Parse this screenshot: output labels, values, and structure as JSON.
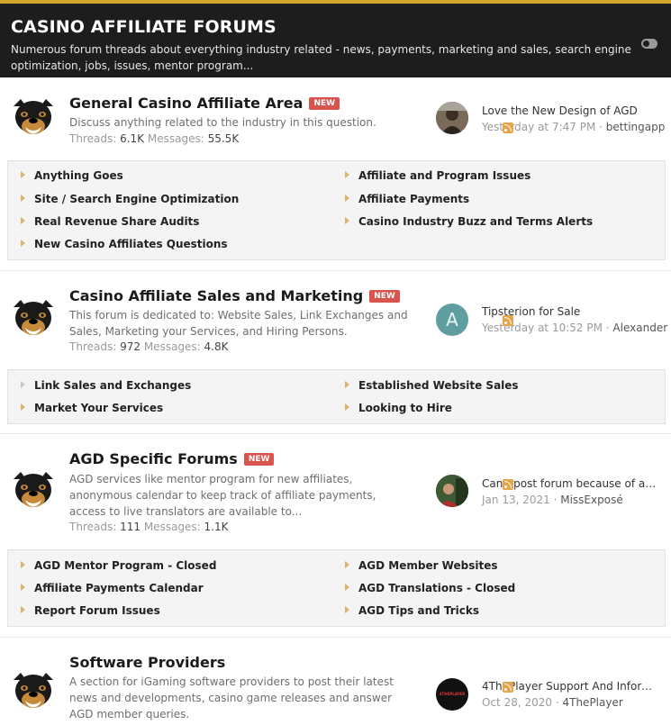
{
  "header": {
    "title": "CASINO AFFILIATE FORUMS",
    "description": "Numerous forum threads about everything industry related - news, payments, marketing and sales, search engine optimization, jobs, issues, mentor program..."
  },
  "badge_new": "NEW",
  "colors": {
    "accent": "#d4a72c",
    "header_bg": "#1d1d1d",
    "badge": "#d9534f",
    "rss": "#e7a54b"
  },
  "forums": [
    {
      "title": "General Casino Affiliate Area",
      "is_new": true,
      "description": "Discuss anything related to the industry in this question.",
      "threads_label": "Threads:",
      "threads": "6.1K",
      "messages_label": "Messages:",
      "messages": "55.5K",
      "latest": {
        "title": "Love the New Design of AGD",
        "date": "Yesterday at 7:47 PM",
        "user": "bettingapp",
        "avatar": "photo"
      },
      "subforums": [
        "Anything Goes",
        "Affiliate and Program Issues",
        "Site / Search Engine Optimization",
        "Affiliate Payments",
        "Real Revenue Share Audits",
        "Casino Industry Buzz and Terms Alerts",
        "New Casino Affiliates Questions"
      ]
    },
    {
      "title": "Casino Affiliate Sales and Marketing",
      "is_new": true,
      "description": "This forum is dedicated to: Website Sales, Link Exchanges and Sales, Marketing your Services, and Hiring Persons.",
      "threads_label": "Threads:",
      "threads": "972",
      "messages_label": "Messages:",
      "messages": "4.8K",
      "latest": {
        "title": "Tipsterion for Sale",
        "date": "Yesterday at 10:52 PM",
        "user": "Alexander",
        "avatar_letter": "A"
      },
      "subforums": [
        "Link Sales and Exchanges",
        "Established Website Sales",
        "Market Your Services",
        "Looking to Hire"
      ]
    },
    {
      "title": "AGD Specific Forums",
      "is_new": true,
      "description": "AGD services like mentor program for new affiliates, anonymous calendar to keep track of affiliate payments, access to live translators are available to...",
      "threads_label": "Threads:",
      "threads": "111",
      "messages_label": "Messages:",
      "messages": "1.1K",
      "latest": {
        "title": "Can't post forum because of ad...",
        "date": "Jan 13, 2021",
        "user": "MissExposé",
        "avatar": "photo"
      },
      "subforums": [
        "AGD Mentor Program - Closed",
        "AGD Member Websites",
        "Affiliate Payments Calendar",
        "AGD Translations - Closed",
        "Report Forum Issues",
        "AGD Tips and Tricks"
      ]
    },
    {
      "title": "Software Providers",
      "is_new": false,
      "description": "A section for iGaming software providers to post their latest news and developments, casino game releases and answer AGD member queries.",
      "latest": {
        "title": "4ThePlayer Support And Informa...",
        "date": "Oct 28, 2020",
        "user": "4ThePlayer",
        "avatar_text": "4THEPLAYER"
      }
    }
  ],
  "separator": "·"
}
